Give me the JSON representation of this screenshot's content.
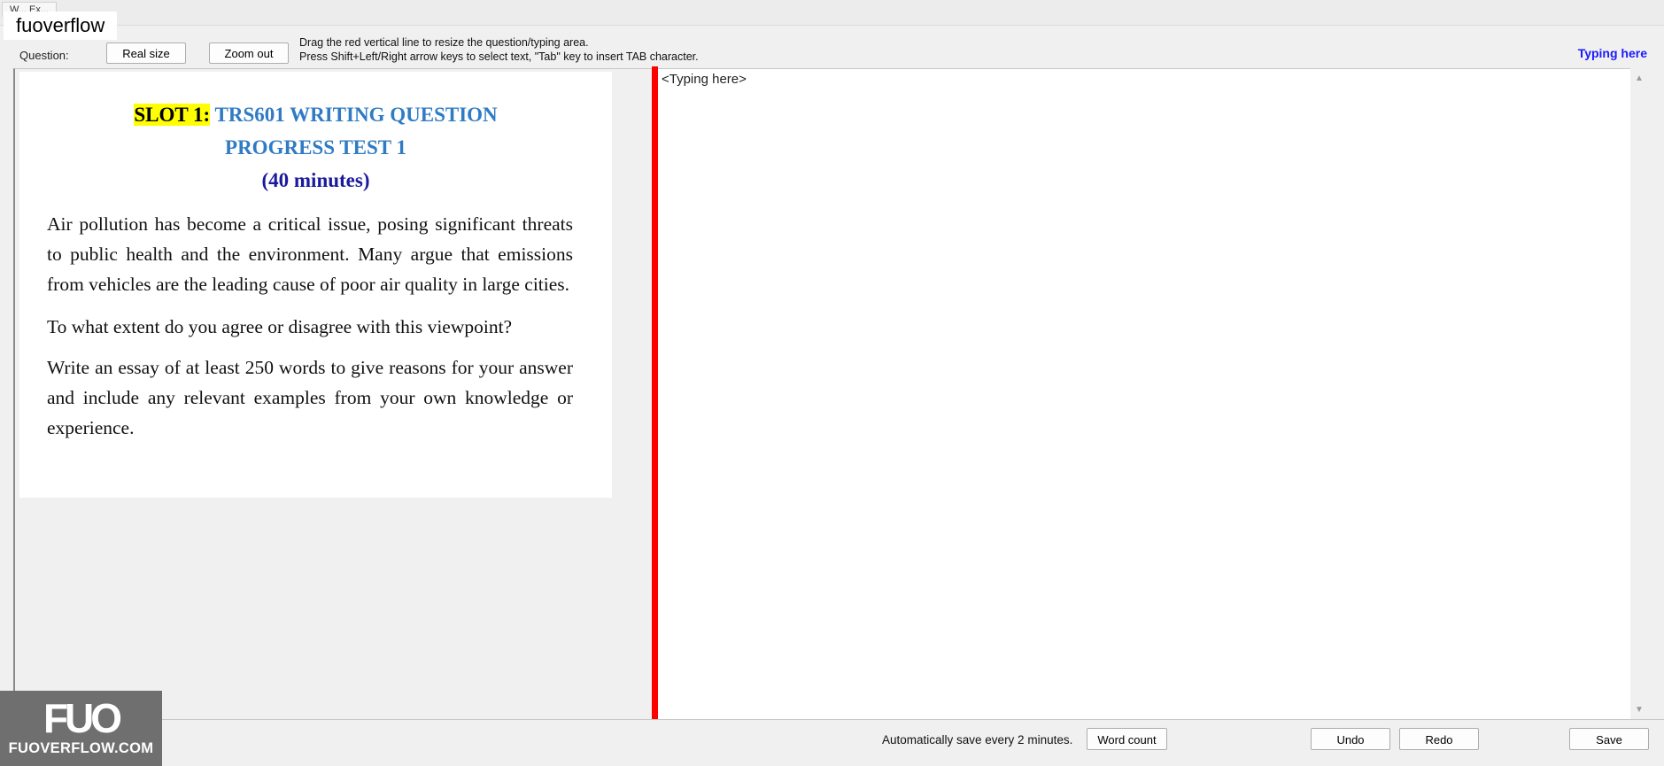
{
  "window": {
    "tab_label": "W... Ex...",
    "watermark": "fuoverflow"
  },
  "toolbar": {
    "question_label": "Question:",
    "real_size_label": "Real size",
    "zoom_out_label": "Zoom out",
    "hint_line1": "Drag the red vertical line to resize the question/typing area.",
    "hint_line2": "Press Shift+Left/Right arrow keys to select text, \"Tab\" key to insert TAB character.",
    "typing_here_link": "Typing here"
  },
  "question": {
    "slot": "SLOT 1:",
    "title_line1": "TRS601 WRITING QUESTION",
    "title_line2": "PROGRESS TEST 1",
    "duration": "(40 minutes)",
    "paragraph1": "Air pollution has become a critical issue, posing significant threats to public health and the environment. Many argue that emissions from vehicles are the leading cause of poor air quality in large cities.",
    "paragraph2": "To what extent do you agree or disagree with this viewpoint?",
    "paragraph3": "Write an essay of at least 250 words to give reasons for your answer and include any relevant examples from your own knowledge or experience."
  },
  "typing": {
    "placeholder": "<Typing here>"
  },
  "bottom": {
    "autosave_text": "Automatically save every 2 minutes.",
    "word_count_label": "Word count",
    "undo_label": "Undo",
    "redo_label": "Redo",
    "save_label": "Save"
  },
  "logo": {
    "mark": "FUO",
    "site": "FUOVERFLOW.COM"
  },
  "colors": {
    "splitter": "#ff0000",
    "title_blue": "#2f7bc4",
    "duration_navy": "#1a1a9e",
    "slot_highlight": "#ffff00",
    "typing_link": "#1a1aff"
  }
}
